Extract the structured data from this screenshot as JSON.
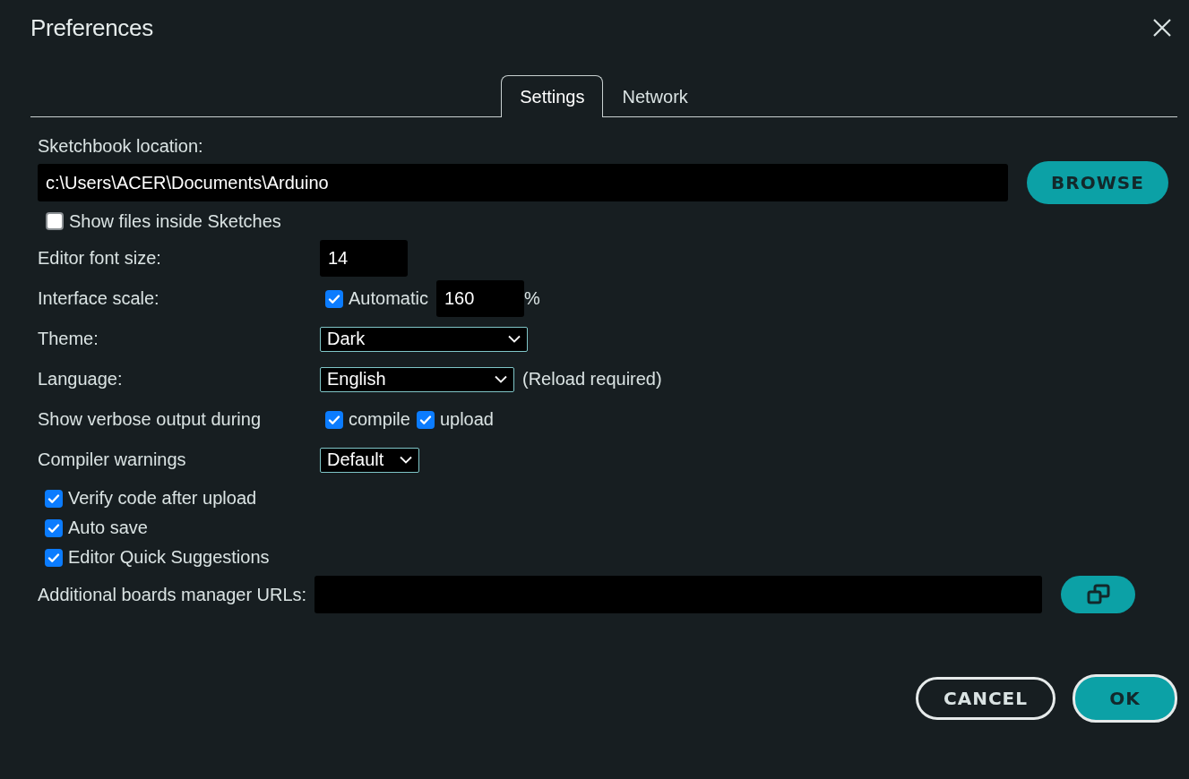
{
  "window": {
    "title": "Preferences"
  },
  "tabs": [
    {
      "label": "Settings",
      "selected": true
    },
    {
      "label": "Network",
      "selected": false
    }
  ],
  "sketchbook": {
    "label": "Sketchbook location:",
    "value": "c:\\Users\\ACER\\Documents\\Arduino",
    "button": "BROWSE"
  },
  "show_files": {
    "label": "Show files inside Sketches",
    "checked": false
  },
  "font_size": {
    "label": "Editor font size:",
    "value": "14"
  },
  "interface_scale": {
    "label": "Interface scale:",
    "automatic": {
      "label": "Automatic",
      "checked": true
    },
    "value": "160",
    "unit": "%"
  },
  "theme": {
    "label": "Theme:",
    "value": "Dark"
  },
  "language": {
    "label": "Language:",
    "value": "English",
    "note": "(Reload required)"
  },
  "verbose": {
    "label": "Show verbose output during",
    "options": [
      {
        "label": "compile",
        "checked": true
      },
      {
        "label": "upload",
        "checked": true
      }
    ]
  },
  "compiler_warnings": {
    "label": "Compiler warnings",
    "value": "Default"
  },
  "checkboxes": [
    {
      "label": "Verify code after upload",
      "checked": true
    },
    {
      "label": "Auto save",
      "checked": true
    },
    {
      "label": "Editor Quick Suggestions",
      "checked": true
    }
  ],
  "boards_urls": {
    "label": "Additional boards manager URLs:"
  },
  "buttons": [
    {
      "label": "CANCEL",
      "kind": "secondary"
    },
    {
      "label": "OK",
      "kind": "primary"
    }
  ]
}
